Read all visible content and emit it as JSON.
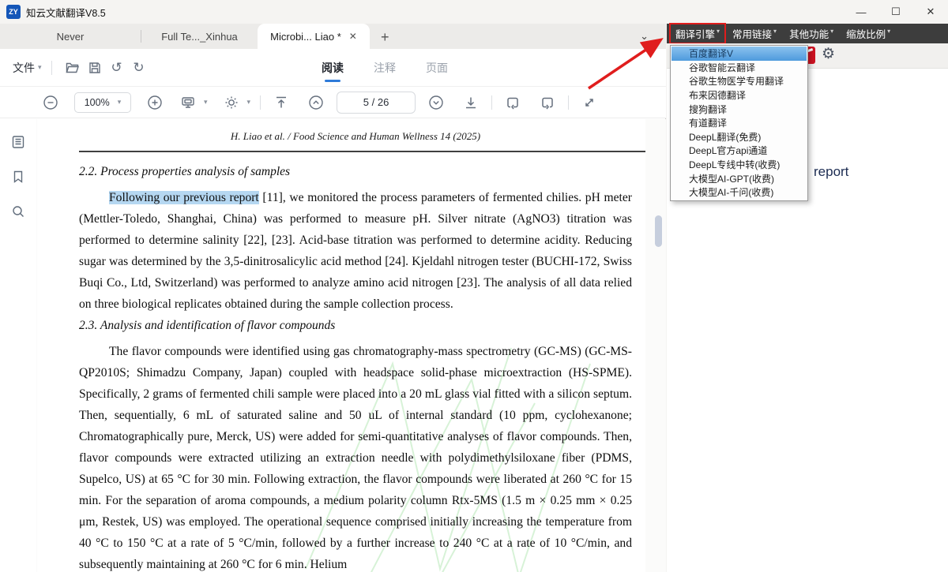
{
  "window": {
    "title": "知云文献翻译V8.5",
    "logo_text": "ZY",
    "minimize": "—",
    "maximize": "☐",
    "close": "✕"
  },
  "tabs": {
    "items": [
      {
        "label": "Never"
      },
      {
        "label": "Full Te..._Xinhua"
      },
      {
        "label": "Microbi... Liao *"
      }
    ],
    "close_glyph": "✕",
    "new_tab_glyph": "+",
    "overflow_glyph": "⌄"
  },
  "toolbar": {
    "file_menu_label": "文件",
    "view_tabs": [
      {
        "label": "阅读"
      },
      {
        "label": "注释"
      },
      {
        "label": "页面"
      }
    ],
    "undo_glyph": "↺",
    "redo_glyph": "↻"
  },
  "pdf_controls": {
    "zoom_level": "100%",
    "page_display": "5 / 26",
    "page_current": 5,
    "page_total": 26
  },
  "right_panel": {
    "menu": [
      "翻译引擎",
      "常用链接",
      "其他功能",
      "缩放比例"
    ],
    "gear_glyph": "⚙",
    "source_text_fragment": "report"
  },
  "engine_menu": {
    "selected_index": 0,
    "items": [
      "百度翻译V",
      "谷歌智能云翻译",
      "谷歌生物医学专用翻译",
      "布来因德翻译",
      "搜狗翻译",
      "有道翻译",
      "DeepL翻译(免费)",
      "DeepL官方api通道",
      "DeepL专线中转(收费)",
      "大模型AI-GPT(收费)",
      "大模型AI-千问(收费)"
    ]
  },
  "document": {
    "running_header": "H. Liao et al. / Food Science and Human Wellness 14 (2025)",
    "section_22_heading": "2.2. Process properties analysis of samples",
    "p1_highlight": "Following our previous report",
    "p1_rest": " [11], we monitored the process parameters of fermented chilies. pH meter (Mettler-Toledo, Shanghai, China) was performed to measure pH. Silver nitrate (AgNO3) titration was performed to determine salinity [22], [23]. Acid-base titration was performed to determine acidity. Reducing sugar was determined by the 3,5-dinitrosalicylic acid method [24]. Kjeldahl nitrogen tester (BUCHI-172, Swiss Buqi Co., Ltd, Switzerland) was performed to analyze amino acid nitrogen [23]. The analysis of all data relied on three biological replicates obtained during the sample collection process.",
    "section_23_heading": "2.3. Analysis and identification of flavor compounds",
    "p2": "The flavor compounds were identified using gas chromatography-mass spectrometry (GC-MS) (GC-MS-QP2010S; Shimadzu Company, Japan) coupled with headspace solid-phase microextraction (HS-SPME). Specifically, 2 grams of fermented chili sample were placed into a 20 mL glass vial fitted with a silicon septum. Then, sequentially, 6 mL of saturated saline and 50 uL of internal standard (10 ppm, cyclohexanone; Chromatographically pure, Merck, US) were added for semi-quantitative analyses of flavor compounds. Then, flavor compounds were extracted utilizing an extraction needle with polydimethylsiloxane fiber (PDMS, Supelco, US) at 65 °C for 30 min. Following extraction, the flavor compounds were liberated at 260 °C for 15 min. For the separation of aroma compounds, a medium polarity column Rtx-5MS (1.5 m × 0.25 mm × 0.25 μm, Restek, US) was employed. The operational sequence comprised initially increasing the temperature from 40 °C to 150 °C at a rate of 5 °C/min, followed by a further increase to 240 °C at a rate of 10 °C/min, and subsequently maintaining at 260 °C for 6 min. Helium"
  },
  "colors": {
    "accent_blue": "#2f7bd9",
    "selection_blue": "#b5d7f1",
    "annotation_red": "#e01d1d",
    "menu_dark": "#3d3d3d",
    "selected_engine_blue": "#4e9add"
  }
}
